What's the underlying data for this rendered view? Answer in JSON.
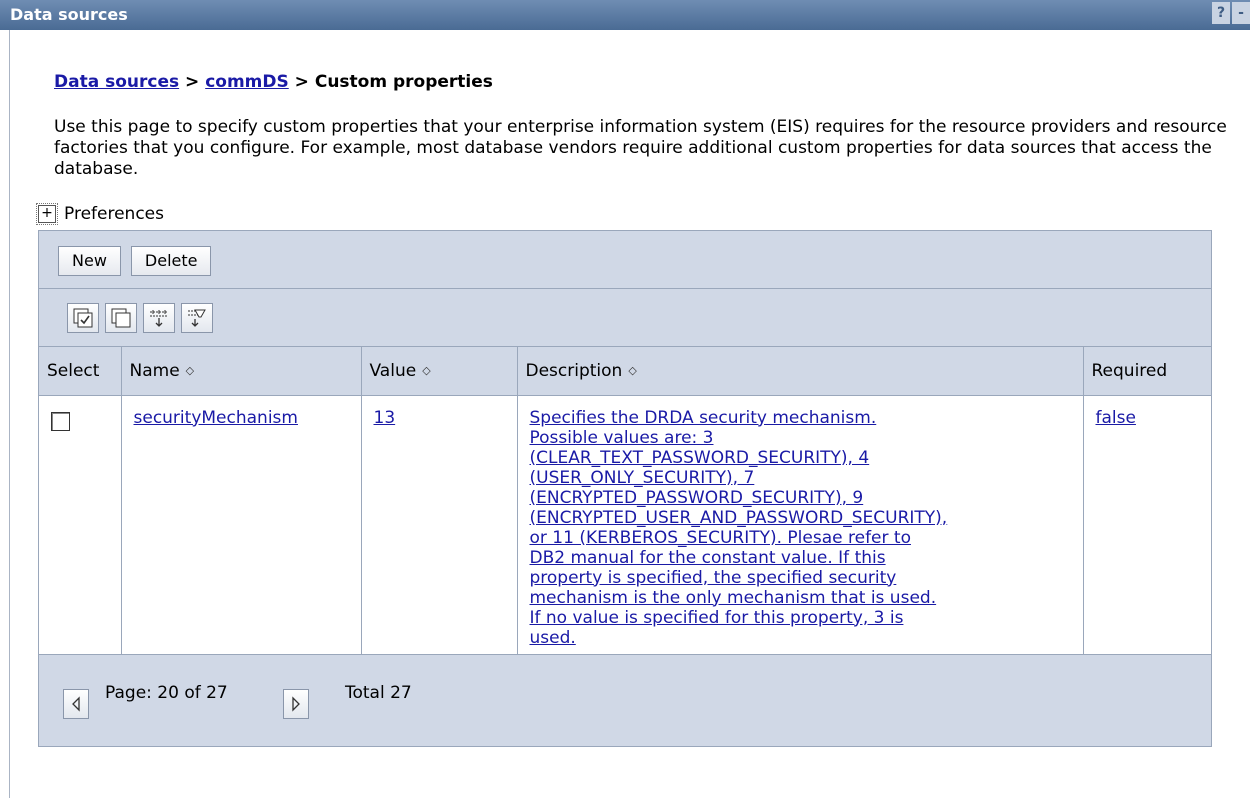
{
  "window": {
    "title": "Data sources",
    "help_label": "?",
    "minimize_label": "-"
  },
  "breadcrumb": {
    "items": [
      "Data sources",
      "commDS"
    ],
    "separator": ">",
    "current": "Custom properties"
  },
  "description": "Use this page to specify custom properties that your enterprise information system (EIS) requires for the resource providers and resource factories that you configure. For example, most database vendors require additional custom properties for data sources that access the database.",
  "preferences": {
    "toggle": "+",
    "label": "Preferences"
  },
  "toolbar": {
    "new_label": "New",
    "delete_label": "Delete",
    "icons": [
      "select-all-icon",
      "deselect-all-icon",
      "show-filter-icon",
      "clear-filter-icon"
    ]
  },
  "table": {
    "columns": {
      "select": "Select",
      "name": "Name",
      "value": "Value",
      "description": "Description",
      "required": "Required"
    },
    "sort_glyph": "◇",
    "rows": [
      {
        "selected": false,
        "name": "securityMechanism",
        "value": "13",
        "description_lines": [
          "Specifies the DRDA security mechanism.",
          "Possible values are: 3",
          "(CLEAR_TEXT_PASSWORD_SECURITY), 4",
          "(USER_ONLY_SECURITY), 7",
          "(ENCRYPTED_PASSWORD_SECURITY), 9",
          "(ENCRYPTED_USER_AND_PASSWORD_SECURITY),",
          "or 11 (KERBEROS_SECURITY). Plesae refer to",
          "DB2 manual for the constant value. If this",
          "property is specified, the specified security",
          "mechanism is the only mechanism that is used.",
          "If no value is specified for this property, 3 is",
          "used."
        ],
        "required": "false"
      }
    ]
  },
  "pagination": {
    "page_text": "Page: 20 of 27",
    "total_text": "Total 27"
  },
  "colors": {
    "title_bar": "#4a6b94",
    "panel_bg": "#d0d8e6",
    "link": "#1a1aa6"
  }
}
